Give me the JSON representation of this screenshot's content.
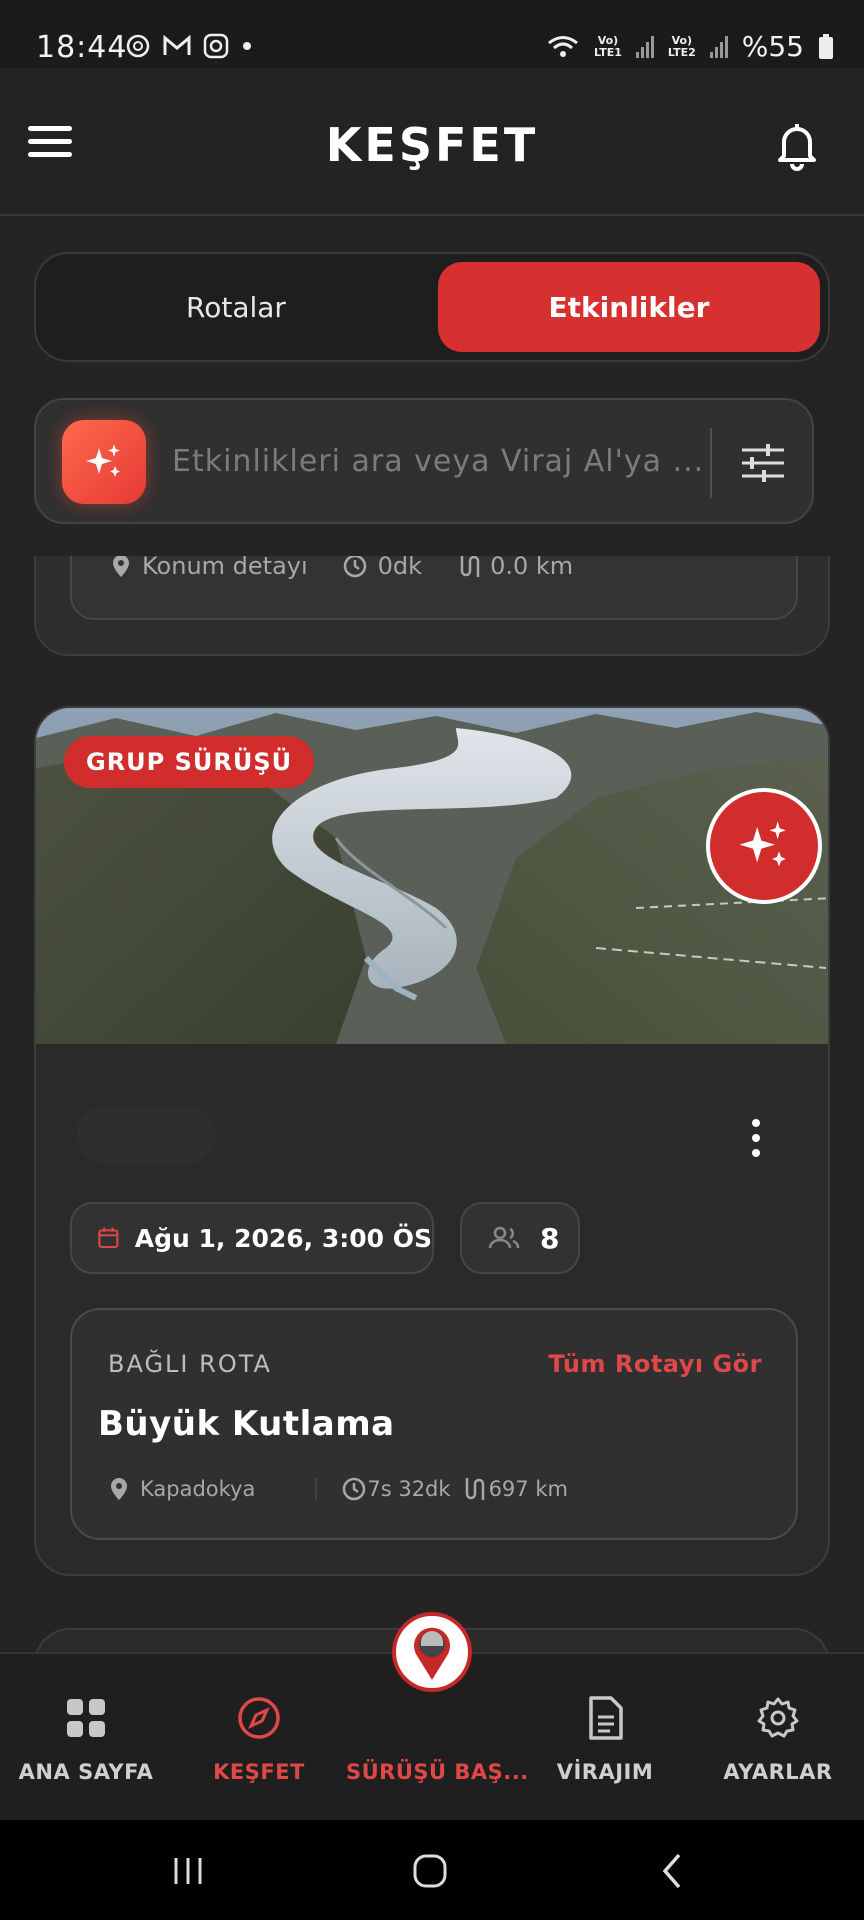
{
  "status_bar": {
    "time": "18:44",
    "icons": [
      "openai-icon",
      "gmail-icon",
      "instagram-icon",
      "dot"
    ],
    "network": [
      "wifi-6-icon",
      "volte-lte1-signal",
      "volte-lte2-signal"
    ],
    "battery": "%55"
  },
  "header": {
    "title": "KEŞFET",
    "menu_icon": "hamburger-menu-icon",
    "notification_icon": "bell-icon"
  },
  "tabs": {
    "routes": "Rotalar",
    "events": "Etkinlikler",
    "active": "Etkinlikler"
  },
  "search": {
    "placeholder": "Etkinlikleri ara veya Viraj Al'ya ...",
    "ai_icon": "sparkles-icon",
    "filter_icon": "sliders-icon"
  },
  "previous_card": {
    "location": "Konum detayı",
    "duration": "0dk",
    "distance": "0.0 km"
  },
  "event_card": {
    "badge": "GRUP SÜRÜŞÜ",
    "date": "Ağu 1, 2026, 3:00 ÖS",
    "participants": "8",
    "route_label": "BAĞLI ROTA",
    "route_link": "Tüm Rotayı Gör",
    "route_name": "Büyük Kutlama",
    "route_location": "Kapadokya",
    "route_duration": "7s 32dk",
    "route_distance": "697 km"
  },
  "bottom_nav": {
    "items": [
      {
        "label": "ANA SAYFA",
        "icon": "grid-icon"
      },
      {
        "label": "KEŞFET",
        "icon": "compass-icon"
      },
      {
        "label": "SÜRÜŞÜ BAŞ...",
        "icon": "helmet-pin-icon"
      },
      {
        "label": "VİRAJIM",
        "icon": "document-icon"
      },
      {
        "label": "AYARLAR",
        "icon": "gear-icon"
      }
    ],
    "active": "KEŞFET"
  },
  "colors": {
    "accent": "#d63031",
    "background": "#242424",
    "card": "#2a2a2a"
  }
}
